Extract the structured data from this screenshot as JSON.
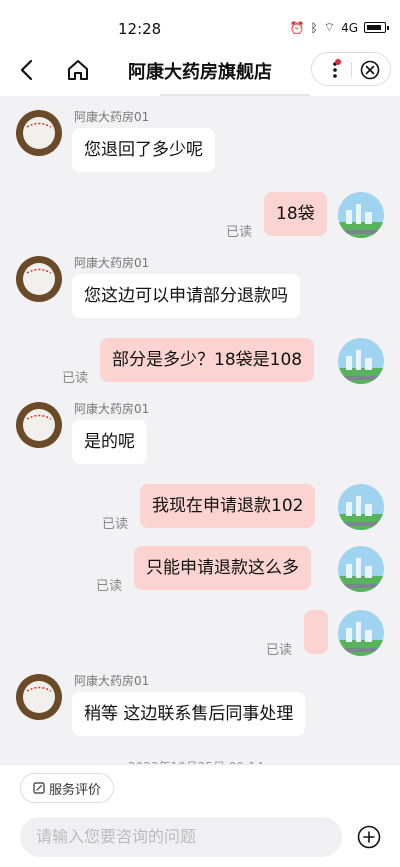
{
  "status": {
    "time": "12:28",
    "signal": "4G"
  },
  "nav": {
    "title": "阿康大药房旗舰店"
  },
  "messages": [
    {
      "side": "in",
      "sender": "阿康大药房01",
      "text": "您退回了多少呢"
    },
    {
      "side": "out",
      "text": "18袋",
      "read": "已读"
    },
    {
      "side": "in",
      "sender": "阿康大药房01",
      "text": "您这边可以申请部分退款吗"
    },
    {
      "side": "out",
      "text": "部分是多少？18袋是108",
      "read": "已读"
    },
    {
      "side": "in",
      "sender": "阿康大药房01",
      "text": "是的呢"
    },
    {
      "side": "out",
      "text": "我现在申请退款102",
      "read": "已读"
    },
    {
      "side": "out",
      "text": "只能申请退款这么多",
      "read": "已读"
    },
    {
      "side": "out",
      "text": "",
      "read": "已读"
    },
    {
      "side": "in",
      "sender": "阿康大药房01",
      "text": "稍等 这边联系售后同事处理"
    }
  ],
  "bottom_timestamp": "2023年10月25日 09:14",
  "footer": {
    "eval_label": "服务评价",
    "input_placeholder": "请输入您要咨询的问题"
  }
}
